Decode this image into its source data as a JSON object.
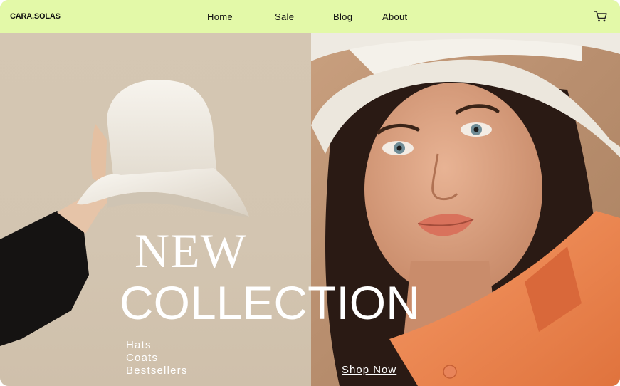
{
  "brand": {
    "logo_text": "CARA.SOLAS"
  },
  "nav": {
    "links": [
      {
        "label": "Home"
      },
      {
        "label": "Sale"
      },
      {
        "label": "Blog"
      },
      {
        "label": "About"
      }
    ],
    "cart_icon": "shopping-cart-icon"
  },
  "hero": {
    "headline_line1": "NEW",
    "headline_line2": "COLLECTION",
    "categories": [
      {
        "label": "Hats"
      },
      {
        "label": "Coats"
      },
      {
        "label": "Bestsellers"
      }
    ],
    "cta_label": "Shop Now"
  },
  "colors": {
    "nav_background": "#e3f9a8",
    "left_panel": "#d5c7b3",
    "text_light": "#ffffff",
    "shirt_orange": "#f08a55"
  }
}
